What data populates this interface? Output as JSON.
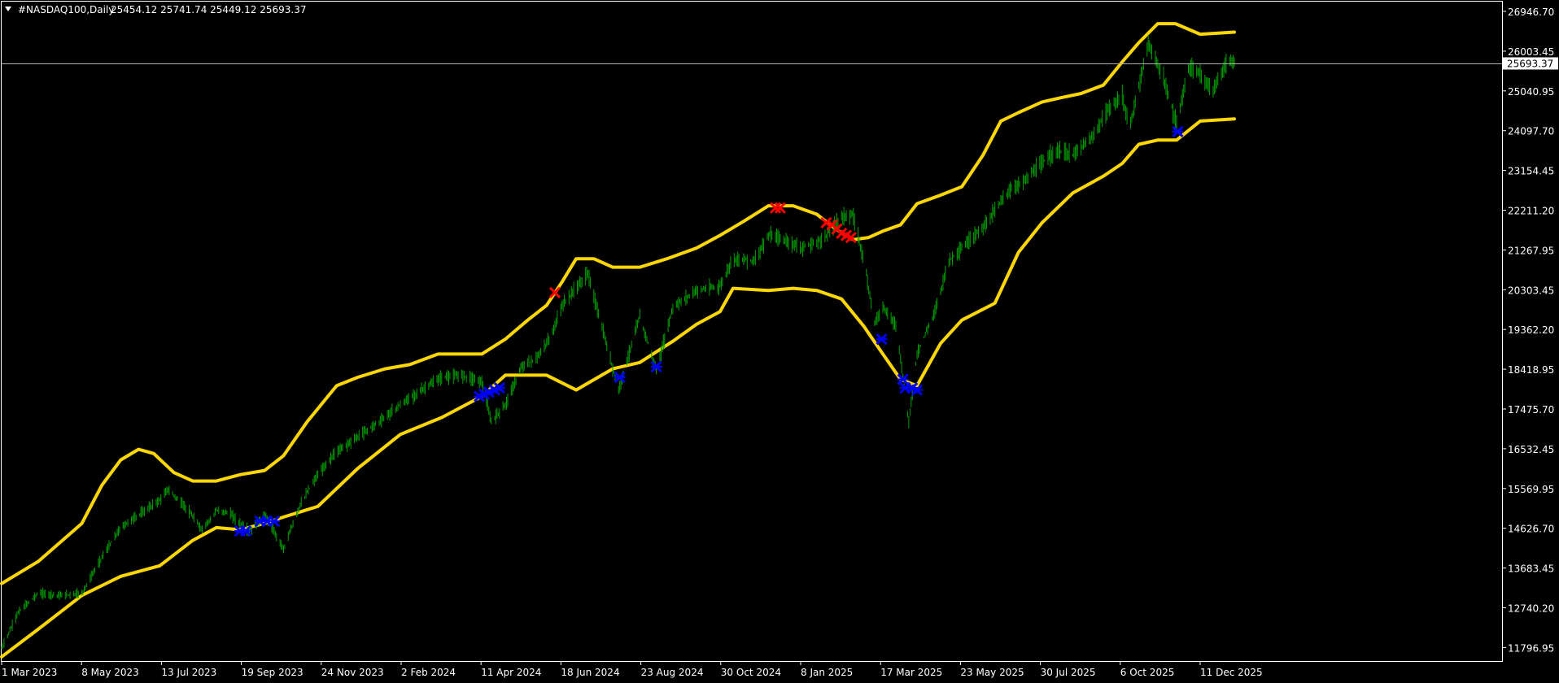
{
  "header": {
    "symbol": "#NASDAQ100,Daily",
    "ohlc": "25454.12 25741.74 25449.12 25693.37"
  },
  "chart_data": {
    "type": "line",
    "title": "#NASDAQ100,Daily 25454.12 25741.74 25449.12 25693.37",
    "ylim": [
      11550,
      27120
    ],
    "y_ticks": [
      "26946.70",
      "26003.45",
      "25040.95",
      "24097.70",
      "23154.45",
      "22211.20",
      "21267.95",
      "20303.45",
      "19362.20",
      "18418.95",
      "17475.70",
      "16532.45",
      "15569.95",
      "14626.70",
      "13683.45",
      "12740.20",
      "11796.95"
    ],
    "x_ticks": [
      "1 Mar 2023",
      "8 May 2023",
      "13 Jul 2023",
      "19 Sep 2023",
      "24 Nov 2023",
      "2 Feb 2024",
      "11 Apr 2024",
      "18 Jun 2024",
      "23 Aug 2024",
      "30 Oct 2024",
      "8 Jan 2025",
      "17 Mar 2025",
      "23 May 2025",
      "30 Jul 2025",
      "6 Oct 2025",
      "11 Dec 2025"
    ],
    "current_price": "25693.37",
    "price_series": {
      "name": "NASDAQ100 Daily",
      "color": "#00a000",
      "points": [
        [
          "2023-03-01",
          11850
        ],
        [
          "2023-03-15",
          12700
        ],
        [
          "2023-04-01",
          13150
        ],
        [
          "2023-04-20",
          13100
        ],
        [
          "2023-05-08",
          13150
        ],
        [
          "2023-05-25",
          14000
        ],
        [
          "2023-06-10",
          14700
        ],
        [
          "2023-06-25",
          15000
        ],
        [
          "2023-07-13",
          15350
        ],
        [
          "2023-07-20",
          15600
        ],
        [
          "2023-08-05",
          15150
        ],
        [
          "2023-08-18",
          14650
        ],
        [
          "2023-08-30",
          15100
        ],
        [
          "2023-09-10",
          15050
        ],
        [
          "2023-09-19",
          14800
        ],
        [
          "2023-09-27",
          14600
        ],
        [
          "2023-10-10",
          15000
        ],
        [
          "2023-10-26",
          14200
        ],
        [
          "2023-11-10",
          15300
        ],
        [
          "2023-11-24",
          15950
        ],
        [
          "2023-12-10",
          16500
        ],
        [
          "2023-12-28",
          16850
        ],
        [
          "2024-01-15",
          17200
        ],
        [
          "2024-02-02",
          17600
        ],
        [
          "2024-02-20",
          17950
        ],
        [
          "2024-03-08",
          18250
        ],
        [
          "2024-03-25",
          18300
        ],
        [
          "2024-04-11",
          18150
        ],
        [
          "2024-04-19",
          17200
        ],
        [
          "2024-05-01",
          17600
        ],
        [
          "2024-05-15",
          18500
        ],
        [
          "2024-05-28",
          18700
        ],
        [
          "2024-06-10",
          19300
        ],
        [
          "2024-06-18",
          19950
        ],
        [
          "2024-07-10",
          20700
        ],
        [
          "2024-07-25",
          19100
        ],
        [
          "2024-08-05",
          17950
        ],
        [
          "2024-08-23",
          19700
        ],
        [
          "2024-09-06",
          18400
        ],
        [
          "2024-09-20",
          19900
        ],
        [
          "2024-10-10",
          20300
        ],
        [
          "2024-10-30",
          20400
        ],
        [
          "2024-11-10",
          21050
        ],
        [
          "2024-11-28",
          21000
        ],
        [
          "2024-12-10",
          21600
        ],
        [
          "2024-12-18",
          21550
        ],
        [
          "2025-01-08",
          21300
        ],
        [
          "2025-01-25",
          21500
        ],
        [
          "2025-02-10",
          22050
        ],
        [
          "2025-02-20",
          22050
        ],
        [
          "2025-03-01",
          21000
        ],
        [
          "2025-03-10",
          19550
        ],
        [
          "2025-03-17",
          19900
        ],
        [
          "2025-03-28",
          19500
        ],
        [
          "2025-04-08",
          17200
        ],
        [
          "2025-04-15",
          18800
        ],
        [
          "2025-04-30",
          19800
        ],
        [
          "2025-05-12",
          21000
        ],
        [
          "2025-05-23",
          21300
        ],
        [
          "2025-06-10",
          21800
        ],
        [
          "2025-06-30",
          22600
        ],
        [
          "2025-07-15",
          22900
        ],
        [
          "2025-07-30",
          23300
        ],
        [
          "2025-08-10",
          23600
        ],
        [
          "2025-08-25",
          23500
        ],
        [
          "2025-09-10",
          23900
        ],
        [
          "2025-09-25",
          24600
        ],
        [
          "2025-10-06",
          24900
        ],
        [
          "2025-10-12",
          24100
        ],
        [
          "2025-10-28",
          26150
        ],
        [
          "2025-11-10",
          25300
        ],
        [
          "2025-11-21",
          24200
        ],
        [
          "2025-12-01",
          25550
        ],
        [
          "2025-12-11",
          25400
        ],
        [
          "2025-12-22",
          25000
        ],
        [
          "2026-01-02",
          25650
        ],
        [
          "2026-01-09",
          25700
        ]
      ]
    },
    "upper_band": {
      "name": "upper band",
      "color": "#ffd700",
      "points": [
        [
          "2023-03-01",
          13380
        ],
        [
          "2023-04-01",
          13900
        ],
        [
          "2023-05-08",
          14800
        ],
        [
          "2023-05-25",
          15700
        ],
        [
          "2023-06-10",
          16300
        ],
        [
          "2023-06-25",
          16550
        ],
        [
          "2023-07-08",
          16450
        ],
        [
          "2023-07-25",
          16000
        ],
        [
          "2023-08-10",
          15800
        ],
        [
          "2023-08-30",
          15800
        ],
        [
          "2023-09-19",
          15950
        ],
        [
          "2023-10-10",
          16050
        ],
        [
          "2023-10-26",
          16400
        ],
        [
          "2023-11-15",
          17200
        ],
        [
          "2023-12-10",
          18050
        ],
        [
          "2023-12-28",
          18250
        ],
        [
          "2024-01-20",
          18450
        ],
        [
          "2024-02-10",
          18550
        ],
        [
          "2024-03-05",
          18800
        ],
        [
          "2024-03-25",
          18800
        ],
        [
          "2024-04-11",
          18800
        ],
        [
          "2024-05-01",
          19150
        ],
        [
          "2024-05-20",
          19600
        ],
        [
          "2024-06-05",
          19950
        ],
        [
          "2024-06-18",
          20500
        ],
        [
          "2024-06-30",
          21050
        ],
        [
          "2024-07-15",
          21050
        ],
        [
          "2024-07-31",
          20850
        ],
        [
          "2024-08-23",
          20850
        ],
        [
          "2024-09-15",
          21050
        ],
        [
          "2024-10-10",
          21300
        ],
        [
          "2024-10-30",
          21600
        ],
        [
          "2024-11-20",
          21950
        ],
        [
          "2024-12-10",
          22300
        ],
        [
          "2024-12-31",
          22300
        ],
        [
          "2025-01-20",
          22100
        ],
        [
          "2025-02-05",
          21750
        ],
        [
          "2025-02-20",
          21500
        ],
        [
          "2025-03-05",
          21550
        ],
        [
          "2025-03-17",
          21700
        ],
        [
          "2025-04-01",
          21850
        ],
        [
          "2025-04-15",
          22350
        ],
        [
          "2025-05-05",
          22550
        ],
        [
          "2025-05-23",
          22750
        ],
        [
          "2025-06-10",
          23500
        ],
        [
          "2025-06-25",
          24300
        ],
        [
          "2025-07-10",
          24500
        ],
        [
          "2025-07-30",
          24750
        ],
        [
          "2025-08-15",
          24850
        ],
        [
          "2025-09-01",
          24950
        ],
        [
          "2025-09-20",
          25150
        ],
        [
          "2025-10-06",
          25700
        ],
        [
          "2025-10-20",
          26150
        ],
        [
          "2025-11-05",
          26600
        ],
        [
          "2025-11-20",
          26600
        ],
        [
          "2025-12-11",
          26350
        ],
        [
          "2026-01-09",
          26400
        ]
      ]
    },
    "lower_band": {
      "name": "lower band",
      "color": "#ffd700",
      "points": [
        [
          "2023-03-01",
          11650
        ],
        [
          "2023-04-01",
          12300
        ],
        [
          "2023-05-08",
          13100
        ],
        [
          "2023-06-10",
          13550
        ],
        [
          "2023-07-13",
          13800
        ],
        [
          "2023-08-10",
          14400
        ],
        [
          "2023-08-30",
          14700
        ],
        [
          "2023-09-19",
          14650
        ],
        [
          "2023-10-10",
          14800
        ],
        [
          "2023-10-26",
          14950
        ],
        [
          "2023-11-24",
          15200
        ],
        [
          "2023-12-28",
          16100
        ],
        [
          "2024-02-02",
          16900
        ],
        [
          "2024-03-08",
          17300
        ],
        [
          "2024-04-11",
          17800
        ],
        [
          "2024-05-01",
          18300
        ],
        [
          "2024-06-05",
          18300
        ],
        [
          "2024-06-30",
          17950
        ],
        [
          "2024-07-31",
          18450
        ],
        [
          "2024-08-23",
          18600
        ],
        [
          "2024-09-20",
          19100
        ],
        [
          "2024-10-10",
          19500
        ],
        [
          "2024-10-30",
          19800
        ],
        [
          "2024-11-10",
          20350
        ],
        [
          "2024-12-10",
          20300
        ],
        [
          "2024-12-31",
          20350
        ],
        [
          "2025-01-20",
          20300
        ],
        [
          "2025-02-10",
          20100
        ],
        [
          "2025-03-01",
          19450
        ],
        [
          "2025-03-17",
          18800
        ],
        [
          "2025-04-01",
          18200
        ],
        [
          "2025-04-15",
          18050
        ],
        [
          "2025-05-05",
          19050
        ],
        [
          "2025-05-23",
          19600
        ],
        [
          "2025-06-20",
          20000
        ],
        [
          "2025-07-10",
          21200
        ],
        [
          "2025-07-30",
          21900
        ],
        [
          "2025-08-25",
          22600
        ],
        [
          "2025-09-20",
          23000
        ],
        [
          "2025-10-06",
          23300
        ],
        [
          "2025-10-20",
          23750
        ],
        [
          "2025-11-05",
          23850
        ],
        [
          "2025-11-21",
          23850
        ],
        [
          "2025-12-11",
          24300
        ],
        [
          "2026-01-09",
          24350
        ]
      ]
    },
    "signals": [
      {
        "date": "2023-09-19",
        "price": 14620,
        "side": "buy"
      },
      {
        "date": "2023-09-24",
        "price": 14620,
        "side": "buy"
      },
      {
        "date": "2023-10-06",
        "price": 14850,
        "side": "buy"
      },
      {
        "date": "2023-10-12",
        "price": 14850,
        "side": "buy"
      },
      {
        "date": "2023-10-18",
        "price": 14850,
        "side": "buy"
      },
      {
        "date": "2024-04-09",
        "price": 17800,
        "side": "buy"
      },
      {
        "date": "2024-04-13",
        "price": 17850,
        "side": "buy"
      },
      {
        "date": "2024-04-17",
        "price": 17900,
        "side": "buy"
      },
      {
        "date": "2024-04-22",
        "price": 17950,
        "side": "buy"
      },
      {
        "date": "2024-04-26",
        "price": 18000,
        "side": "buy"
      },
      {
        "date": "2024-06-12",
        "price": 20250,
        "side": "sell"
      },
      {
        "date": "2024-08-06",
        "price": 18250,
        "side": "buy"
      },
      {
        "date": "2024-09-06",
        "price": 18500,
        "side": "buy"
      },
      {
        "date": "2024-12-16",
        "price": 22250,
        "side": "sell"
      },
      {
        "date": "2024-12-20",
        "price": 22250,
        "side": "sell"
      },
      {
        "date": "2025-01-28",
        "price": 21900,
        "side": "sell"
      },
      {
        "date": "2025-02-02",
        "price": 21850,
        "side": "sell"
      },
      {
        "date": "2025-02-06",
        "price": 21750,
        "side": "sell"
      },
      {
        "date": "2025-02-10",
        "price": 21650,
        "side": "sell"
      },
      {
        "date": "2025-02-14",
        "price": 21600,
        "side": "sell"
      },
      {
        "date": "2025-02-18",
        "price": 21550,
        "side": "sell"
      },
      {
        "date": "2025-03-16",
        "price": 19150,
        "side": "buy"
      },
      {
        "date": "2025-04-03",
        "price": 18200,
        "side": "buy"
      },
      {
        "date": "2025-04-05",
        "price": 18000,
        "side": "buy"
      },
      {
        "date": "2025-04-11",
        "price": 18000,
        "side": "buy"
      },
      {
        "date": "2025-04-15",
        "price": 17950,
        "side": "buy"
      },
      {
        "date": "2025-11-22",
        "price": 24050,
        "side": "buy"
      }
    ]
  },
  "colors": {
    "background": "#000000",
    "grid_axis": "#ffffff",
    "candles": "#00a000",
    "bands": "#ffd700",
    "buy_marker": "#0000ff",
    "sell_marker": "#ff0000",
    "price_line": "#b0b0b0"
  }
}
